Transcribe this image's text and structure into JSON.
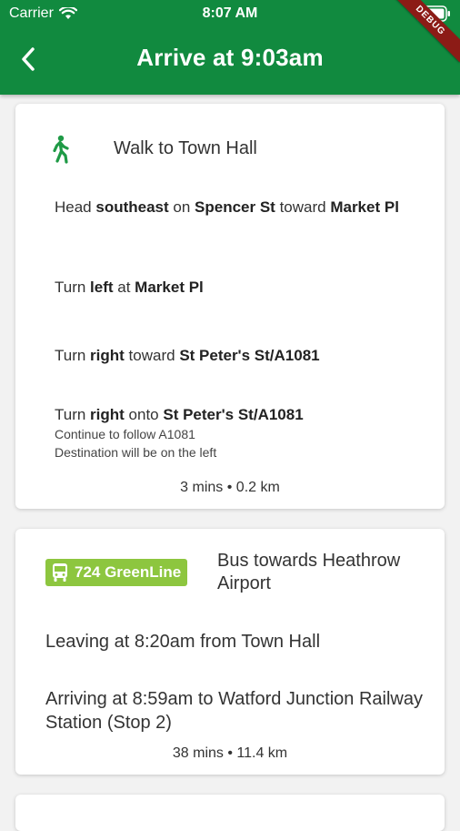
{
  "status_bar": {
    "carrier": "Carrier",
    "time": "8:07 AM"
  },
  "header": {
    "title": "Arrive at 9:03am",
    "debug_label": "DEBUG",
    "background": "#118a3f"
  },
  "walk": {
    "icon": "walk-icon",
    "title": "Walk to Town Hall",
    "steps": [
      {
        "pre": "Head ",
        "b1": "southeast",
        "mid": " on ",
        "b2": "Spencer St",
        "post": " toward ",
        "b3": "Market Pl"
      },
      {
        "pre": "Turn ",
        "b1": "left",
        "mid": " at ",
        "b2": "Market Pl"
      },
      {
        "pre": "Turn ",
        "b1": "right",
        "mid": " toward ",
        "b2": "St Peter's St/A1081"
      },
      {
        "pre": "Turn ",
        "b1": "right",
        "mid": " onto ",
        "b2": "St Peter's St/A1081",
        "note1": "Continue to follow A1081",
        "note2": "Destination will be on the left"
      }
    ],
    "summary": "3 mins • 0.2 km",
    "accent": "#1f9a46"
  },
  "bus": {
    "icon": "bus-icon",
    "route": "724 GreenLine",
    "route_color": "#8dc63f",
    "towards": "Bus towards Heathrow Airport",
    "leaving": "Leaving at 8:20am from Town Hall",
    "arriving": "Arriving at 8:59am to Watford Junction Railway Station (Stop 2)",
    "summary": "38 mins • 11.4 km"
  }
}
